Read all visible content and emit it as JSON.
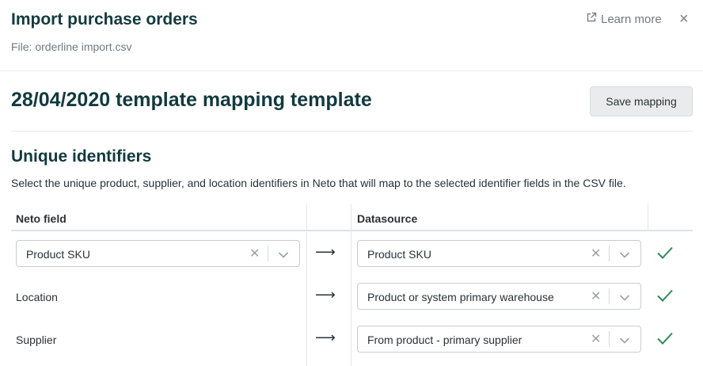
{
  "header": {
    "title": "Import purchase orders",
    "file": "File: orderline import.csv",
    "learn_more": "Learn more",
    "close_glyph": "×",
    "learn_icon": "external-link-icon"
  },
  "template": {
    "title": "28/04/2020 template mapping template",
    "save_label": "Save mapping"
  },
  "section": {
    "title": "Unique identifiers",
    "description": "Select the unique product, supplier, and location identifiers in Neto that will map to the selected identifier fields in the CSV file."
  },
  "table": {
    "col_neto": "Neto field",
    "col_datasource": "Datasource",
    "arrow_glyph": "⟶",
    "rows": [
      {
        "neto_field": "Product SKU",
        "neto_is_select": true,
        "datasource": "Product SKU",
        "status": "mapped"
      },
      {
        "neto_field": "Location",
        "neto_is_select": false,
        "datasource": "Product or system primary warehouse",
        "status": "mapped"
      },
      {
        "neto_field": "Supplier",
        "neto_is_select": false,
        "datasource": "From product - primary supplier",
        "status": "mapped"
      }
    ]
  },
  "colors": {
    "heading": "#123a3f",
    "check": "#2e8b57",
    "muted": "#727a7e"
  }
}
